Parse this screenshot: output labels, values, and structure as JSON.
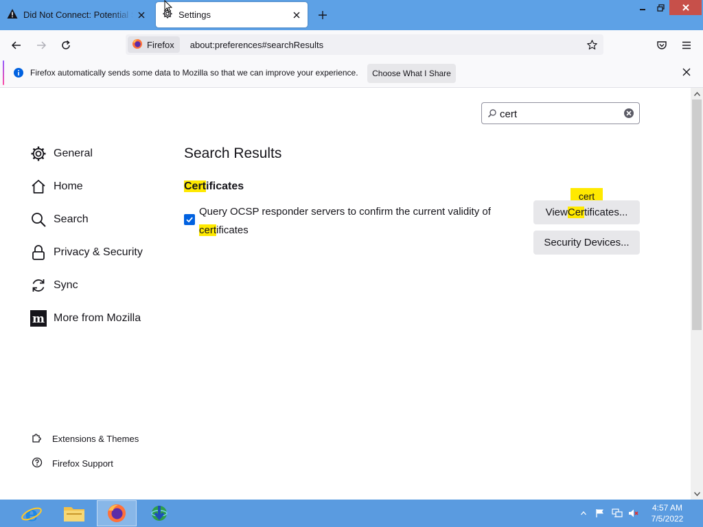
{
  "tabs": [
    {
      "label": "Did Not Connect: Potential Security Issue",
      "active": false
    },
    {
      "label": "Settings",
      "active": true
    }
  ],
  "urlbar": {
    "identity_label": "Firefox",
    "url": "about:preferences#searchResults"
  },
  "notification": {
    "text": "Firefox automatically sends some data to Mozilla so that we can improve your experience.",
    "button_label": "Choose What I Share"
  },
  "search": {
    "value": "cert"
  },
  "categories": [
    {
      "label": "General",
      "icon": "gear-icon"
    },
    {
      "label": "Home",
      "icon": "home-icon"
    },
    {
      "label": "Search",
      "icon": "search-icon"
    },
    {
      "label": "Privacy & Security",
      "icon": "lock-icon"
    },
    {
      "label": "Sync",
      "icon": "sync-icon"
    },
    {
      "label": "More from Mozilla",
      "icon": "mozilla-icon"
    }
  ],
  "footer_links": [
    {
      "label": "Extensions & Themes",
      "icon": "puzzle-icon"
    },
    {
      "label": "Firefox Support",
      "icon": "help-icon"
    }
  ],
  "main": {
    "heading": "Search Results",
    "section": {
      "title_highlight": "Cert",
      "title_rest": "ificates",
      "checkbox": {
        "checked": true,
        "label_main": "Query OCSP responder servers to confirm the current validity of ",
        "label_highlight": "cert",
        "label_rest": "ificates"
      },
      "view_button": {
        "prefix": "View ",
        "highlight": "Cer",
        "rest": "tificates..."
      },
      "devices_button": {
        "label": "Security Devices..."
      },
      "tooltip": "cert"
    }
  },
  "taskbar": {
    "apps": [
      "internet-explorer-icon",
      "file-explorer-icon",
      "firefox-icon",
      "download-manager-icon"
    ],
    "time": "4:57 AM",
    "date": "7/5/2022"
  },
  "colors": {
    "tabbar": "#5da1e6",
    "highlight": "#ffe900",
    "accent": "#0061e0",
    "taskbar": "#5a9be0"
  }
}
